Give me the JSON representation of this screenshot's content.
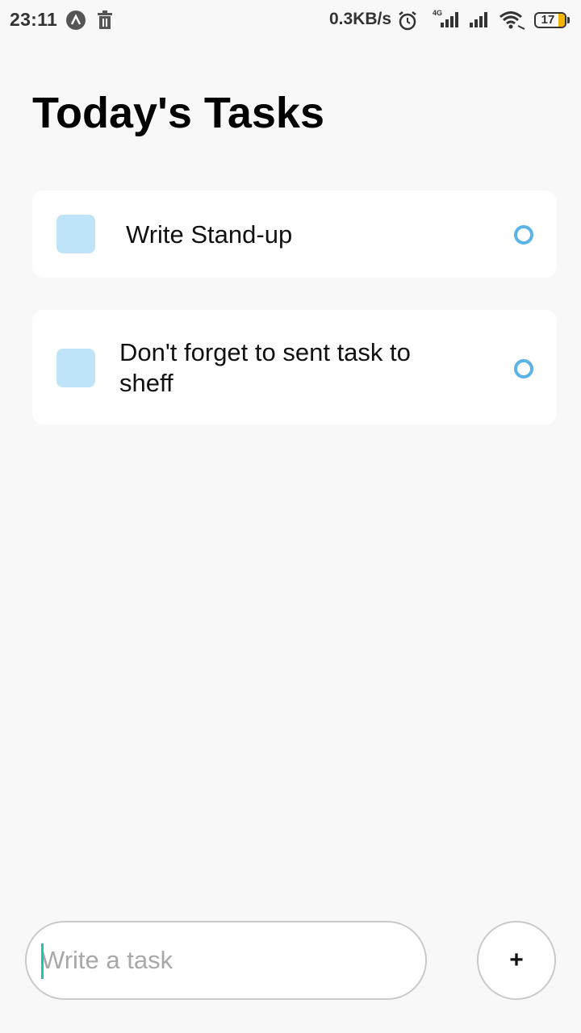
{
  "status_bar": {
    "time": "23:11",
    "network_speed": "0.3KB/s",
    "network_type": "4G",
    "battery_level": "17",
    "icons": [
      "app-icon",
      "trash-icon",
      "alarm-icon",
      "signal-4g-icon",
      "signal-icon",
      "wifi-icon",
      "battery-icon"
    ],
    "battery_color": "#f5b400"
  },
  "header": {
    "title": "Today's Tasks"
  },
  "tasks": [
    {
      "text": "Write Stand-up",
      "completed": false
    },
    {
      "text": "Don't forget to sent task to sheff",
      "completed": false
    }
  ],
  "composer": {
    "placeholder": "Write a task",
    "value": "",
    "add_label": "+"
  },
  "colors": {
    "background": "#f8f8f8",
    "card": "#ffffff",
    "task_square": "#bfe3f7",
    "task_circle": "#5ab4e6",
    "caret": "#1fc3b0"
  }
}
